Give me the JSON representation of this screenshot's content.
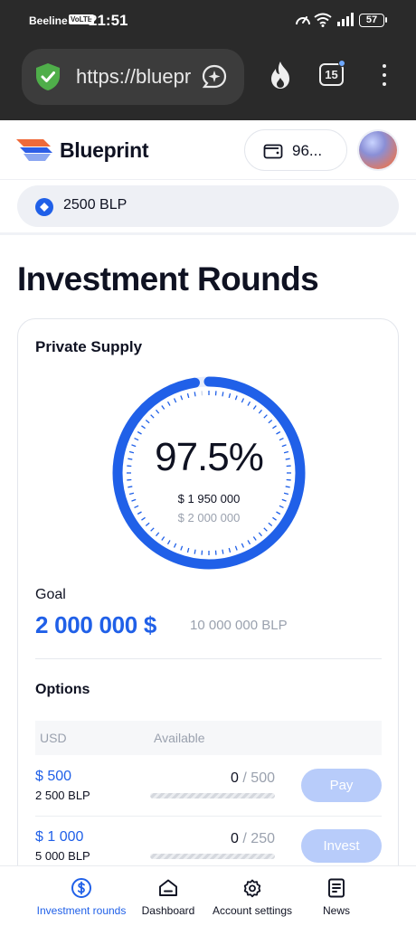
{
  "status_bar": {
    "carrier": "Beeline",
    "volte": "VoLTE",
    "time": "21:51",
    "battery": "57"
  },
  "browser": {
    "url": "https://blueprint",
    "tab_count": "15"
  },
  "header": {
    "brand": "Blueprint",
    "wallet_value": "96...",
    "accent": "#2060e8"
  },
  "balance": {
    "text": "2500 BLP"
  },
  "page": {
    "title": "Investment Rounds"
  },
  "card": {
    "title": "Private Supply",
    "progress_text": "97.5%",
    "progress_value": 0.975,
    "raised": "$ 1 950 000",
    "target": "$ 2 000 000",
    "goal_label": "Goal",
    "goal_usd": "2 000 000 $",
    "goal_blp": "10 000 000 BLP"
  },
  "options": {
    "title": "Options",
    "columns": [
      "USD",
      "Available"
    ],
    "rows": [
      {
        "usd": "$ 500",
        "blp": "2 500 BLP",
        "available": "0",
        "total": "500",
        "fill": 0,
        "button": "Pay"
      },
      {
        "usd": "$ 1 000",
        "blp": "5 000 BLP",
        "available": "0",
        "total": "250",
        "fill": 0,
        "button": "Invest"
      }
    ]
  },
  "nav": {
    "items": [
      {
        "label": "Investment rounds",
        "icon": "dollar-circle-icon",
        "active": true
      },
      {
        "label": "Dashboard",
        "icon": "home-icon",
        "active": false
      },
      {
        "label": "Account settings",
        "icon": "gear-icon",
        "active": false
      },
      {
        "label": "News",
        "icon": "document-icon",
        "active": false
      }
    ]
  }
}
